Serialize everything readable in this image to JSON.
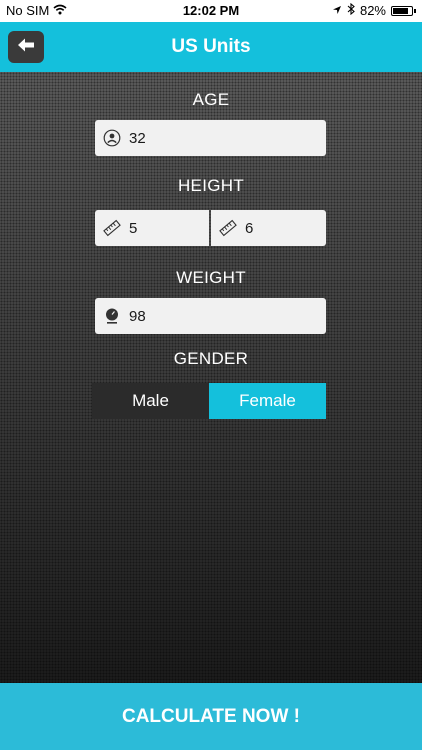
{
  "status_bar": {
    "carrier": "No SIM",
    "time": "12:02 PM",
    "battery": "82%",
    "battery_level": 0.82
  },
  "header": {
    "title": "US Units",
    "back_icon": "arrow-left-icon",
    "accent_color": "#14c0dc"
  },
  "form": {
    "age": {
      "label": "AGE",
      "value": "32",
      "icon": "person-icon"
    },
    "height": {
      "label": "HEIGHT",
      "feet_value": "5",
      "inches_value": "6",
      "icon": "ruler-icon"
    },
    "weight": {
      "label": "WEIGHT",
      "value": "98",
      "icon": "scale-icon"
    },
    "gender": {
      "label": "GENDER",
      "options": [
        "Male",
        "Female"
      ],
      "selected": "Female",
      "selected_color": "#14c0dc",
      "unselected_color": "#2b2b2b"
    }
  },
  "footer": {
    "calculate_label": "CALCULATE NOW !"
  }
}
